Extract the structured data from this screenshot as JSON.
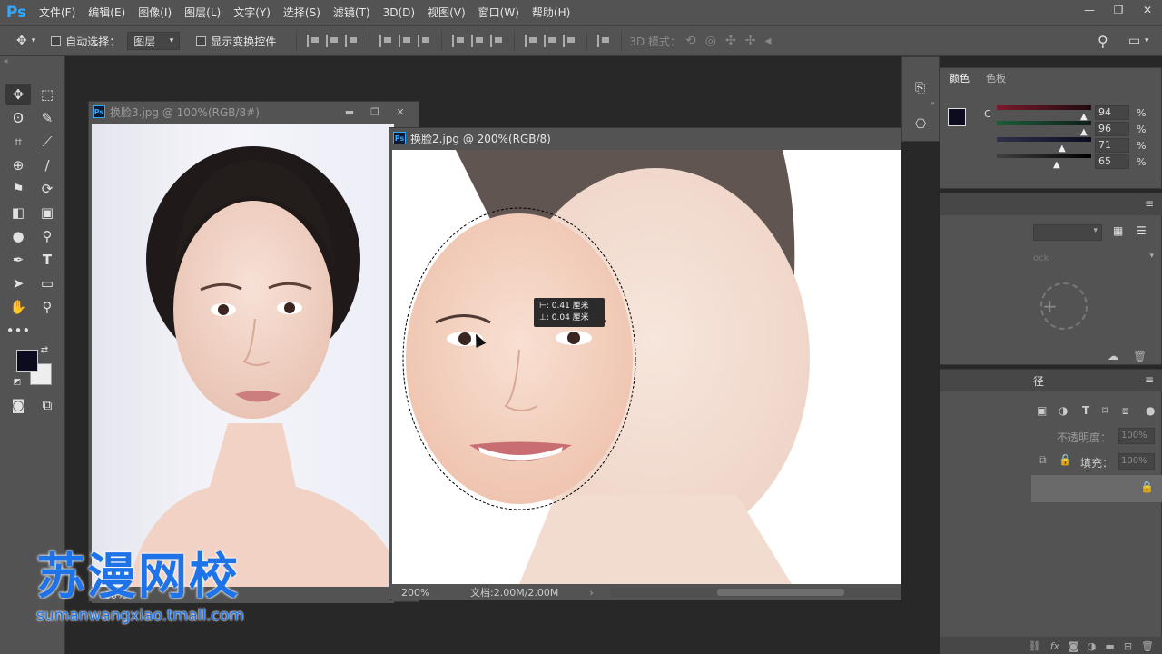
{
  "app": {
    "logo": "Ps",
    "menus": [
      "文件(F)",
      "编辑(E)",
      "图像(I)",
      "图层(L)",
      "文字(Y)",
      "选择(S)",
      "滤镜(T)",
      "3D(D)",
      "视图(V)",
      "窗口(W)",
      "帮助(H)"
    ],
    "window_controls": [
      "—",
      "❐",
      "✕"
    ]
  },
  "options": {
    "auto_select_label": "自动选择：",
    "auto_select_value": "图层",
    "show_transform_label": "显示变换控件",
    "mode_3d_label": "3D 模式："
  },
  "docs": {
    "doc1": {
      "title": "换脸3.jpg @ 100%(RGB/8#)",
      "zoom": "00%"
    },
    "doc2": {
      "title": "换脸2.jpg @ 200%(RGB/8)",
      "zoom": "200%",
      "doc_info": "文档:2.00M/2.00M",
      "measure_x": "0.41 厘米",
      "measure_y": "0.04 厘米"
    }
  },
  "color_panel": {
    "tabs": [
      "颜色",
      "色板"
    ],
    "channel_label": "C",
    "values": [
      "94",
      "96",
      "71",
      "65"
    ],
    "unit": "%"
  },
  "layers_panel": {
    "paths_tab": "径",
    "opacity_label": "不透明度：",
    "opacity_value": "100%",
    "fill_label": "填充：",
    "fill_value": "100%",
    "lock_hint": "ock"
  },
  "watermark": {
    "title": "苏漫网校",
    "url": "sumanwangxiao.tmall.com"
  },
  "colors": {
    "ui_gray": "#535353",
    "canvas": "#282828",
    "accent": "#31a8ff",
    "watermark": "#1e73e8"
  }
}
